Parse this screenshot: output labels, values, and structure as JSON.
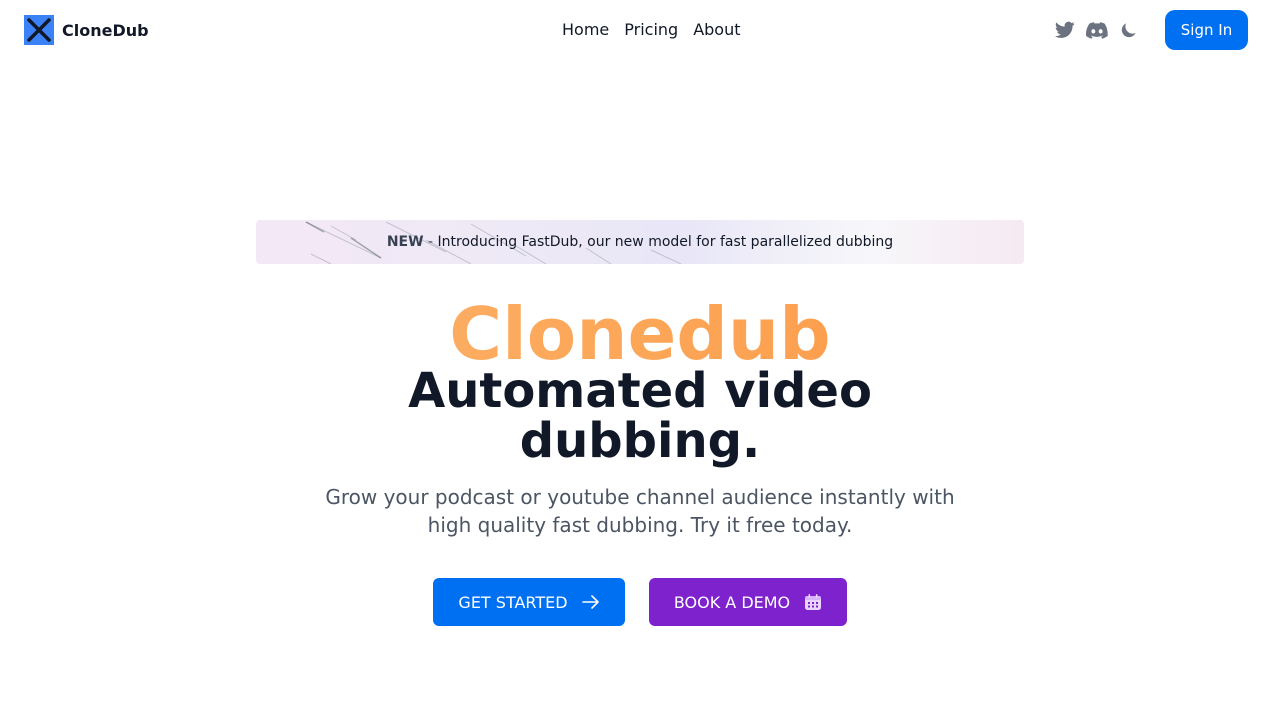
{
  "header": {
    "brand": "CloneDub",
    "nav": [
      {
        "label": "Home"
      },
      {
        "label": "Pricing"
      },
      {
        "label": "About"
      }
    ],
    "icons": [
      "twitter-icon",
      "discord-icon",
      "moon-icon"
    ],
    "sign_in_label": "Sign In"
  },
  "announcement": {
    "badge": "NEW",
    "separator": " - ",
    "text": "Introducing FastDub, our new model for fast parallelized dubbing"
  },
  "hero": {
    "brand_title": "Clonedub",
    "headline_line1": "Automated video",
    "headline_line2": "dubbing.",
    "subtext_line1": "Grow your podcast or youtube channel audience instantly with",
    "subtext_line2": "high quality fast dubbing. Try it free today."
  },
  "cta": {
    "get_started": "GET STARTED",
    "book_demo": "BOOK A DEMO"
  },
  "colors": {
    "primary_blue": "#0070f3",
    "purple": "#7e22ce",
    "brand_gradient_start": "#fdba74",
    "brand_gradient_end": "#fb923c",
    "icon_gray": "#6b7280"
  }
}
